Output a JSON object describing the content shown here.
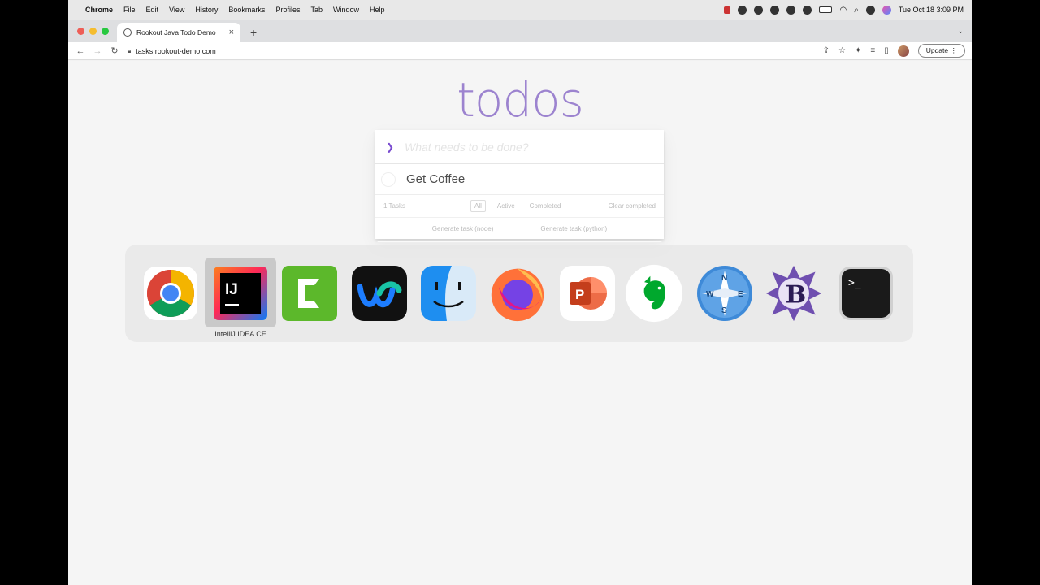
{
  "menubar": {
    "app_name": "Chrome",
    "items": [
      "File",
      "Edit",
      "View",
      "History",
      "Bookmarks",
      "Profiles",
      "Tab",
      "Window",
      "Help"
    ],
    "clock": "Tue Oct 18  3:09 PM"
  },
  "browser": {
    "tab_title": "Rookout Java Todo Demo",
    "url": "tasks.rookout-demo.com",
    "update_label": "Update"
  },
  "todo": {
    "title": "todos",
    "new_placeholder": "What needs to be done?",
    "items": [
      {
        "label": "Get Coffee",
        "completed": false
      }
    ],
    "count_label": "1 Tasks",
    "filters": [
      "All",
      "Active",
      "Completed"
    ],
    "selected_filter": "All",
    "clear_label": "Clear completed",
    "generate_node": "Generate task (node)",
    "generate_python": "Generate task (python)"
  },
  "app_switcher": {
    "apps": [
      "chrome",
      "intellij-idea",
      "camtasia",
      "webex",
      "finder",
      "firefox",
      "powerpoint",
      "evernote",
      "maps-compass",
      "bbedit",
      "terminal"
    ],
    "selected_label": "IntelliJ IDEA CE"
  },
  "colors": {
    "todo_title": "#8c6ec8",
    "accent": "#7a4cd0"
  }
}
